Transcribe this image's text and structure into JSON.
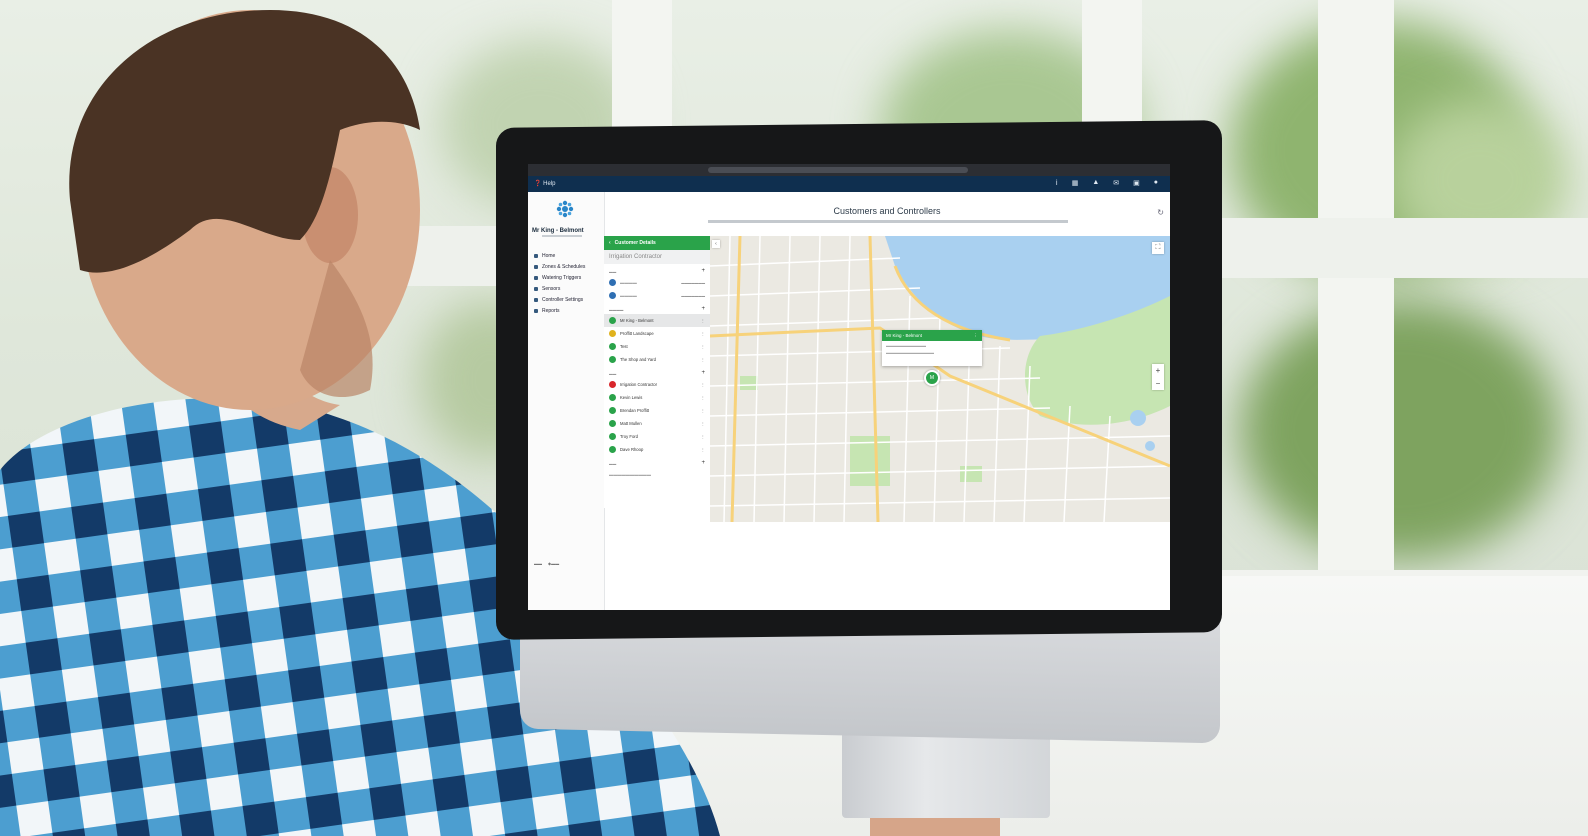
{
  "app": {
    "help_label": "Help",
    "brand_name": "Mr King - Belmont"
  },
  "nav": {
    "items": [
      {
        "label": "Home",
        "icon": "home-icon"
      },
      {
        "label": "Zones & Schedules",
        "icon": "schedule-icon"
      },
      {
        "label": "Watering Triggers",
        "icon": "trigger-icon"
      },
      {
        "label": "Sensors",
        "icon": "sensor-icon"
      },
      {
        "label": "Controller Settings",
        "icon": "wrench-icon"
      },
      {
        "label": "Reports",
        "icon": "report-icon"
      }
    ]
  },
  "header": {
    "title": "Customers and Controllers"
  },
  "panel": {
    "back_label": "Customer Details",
    "customer_name": "Irrigation Contractor",
    "controllers": [
      {
        "label": "Mr King - Belmont",
        "color": "#2aa34a",
        "selected": true
      },
      {
        "label": "Proffitt Landscape",
        "color": "#e0b21d",
        "selected": false
      },
      {
        "label": "Test",
        "color": "#2aa34a",
        "selected": false
      },
      {
        "label": "The Shop and Yard",
        "color": "#2aa34a",
        "selected": false
      }
    ],
    "users": [
      {
        "label": "Irrigation Contractor",
        "color": "#d8262b"
      },
      {
        "label": "Kevin Lewis",
        "color": "#2aa34a"
      },
      {
        "label": "Brendan Proffitt",
        "color": "#2aa34a"
      },
      {
        "label": "Matt Mullen",
        "color": "#2aa34a"
      },
      {
        "label": "Troy Ford",
        "color": "#2aa34a"
      },
      {
        "label": "Dave Rhoop",
        "color": "#2aa34a"
      }
    ]
  },
  "map": {
    "popup_title": "Mr King - Belmont",
    "pin_label": "M",
    "zoom_in": "+",
    "zoom_out": "−"
  },
  "colors": {
    "accent": "#2aa34a",
    "appbar": "#0f2f4f"
  }
}
